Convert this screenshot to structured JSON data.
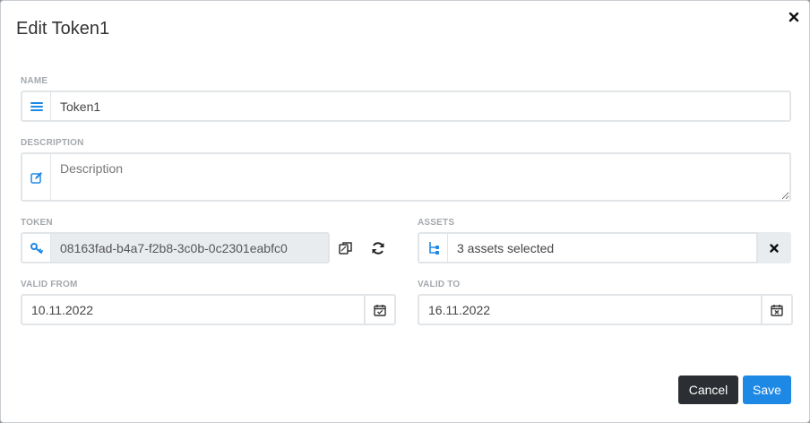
{
  "dialog": {
    "title": "Edit Token1"
  },
  "fields": {
    "name": {
      "label": "NAME",
      "value": "Token1",
      "icon": "list-icon"
    },
    "description": {
      "label": "DESCRIPTION",
      "value": "",
      "placeholder": "Description",
      "icon": "edit-icon"
    },
    "token": {
      "label": "TOKEN",
      "value": "08163fad-b4a7-f2b8-3c0b-0c2301eabfc0",
      "icon": "key-icon"
    },
    "assets": {
      "label": "ASSETS",
      "value": "3 assets selected",
      "icon": "hierarchy-icon"
    },
    "valid_from": {
      "label": "VALID FROM",
      "value": "10.11.2022",
      "icon": "calendar-check-icon"
    },
    "valid_to": {
      "label": "VALID TO",
      "value": "16.11.2022",
      "icon": "calendar-x-icon"
    }
  },
  "buttons": {
    "cancel": "Cancel",
    "save": "Save"
  },
  "colors": {
    "accent": "#1e88e5",
    "dark": "#2b2f33",
    "label": "#a4a8ad",
    "border": "#e2e5e8"
  }
}
